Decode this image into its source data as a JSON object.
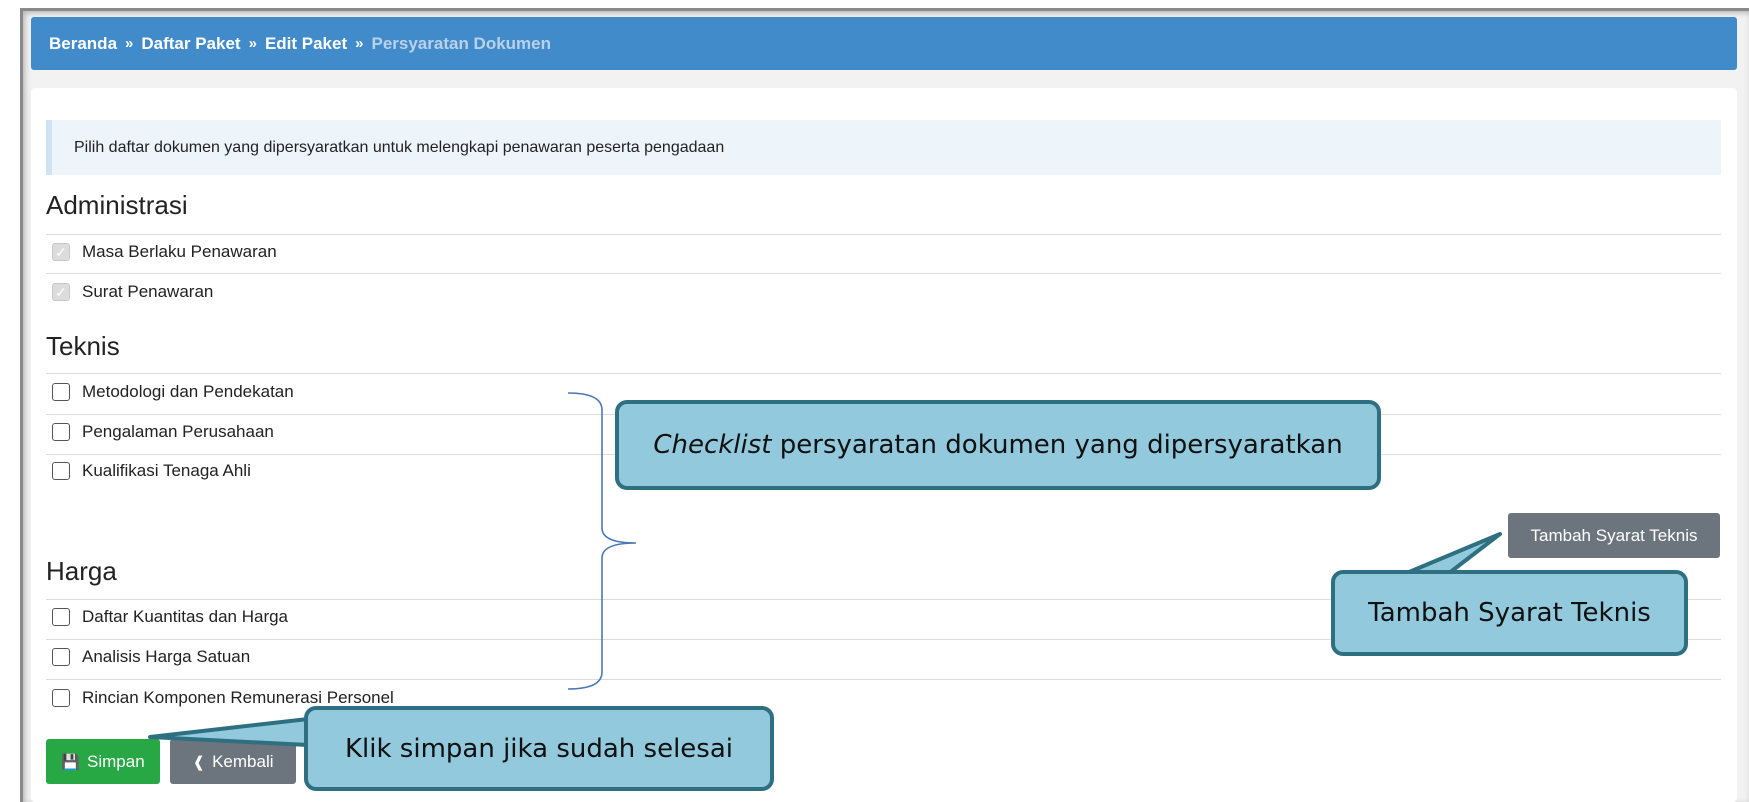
{
  "breadcrumb": {
    "items": [
      "Beranda",
      "Daftar Paket",
      "Edit Paket"
    ],
    "current": "Persyaratan Dokumen",
    "separator": "»"
  },
  "info_text": "Pilih daftar dokumen yang dipersyaratkan untuk melengkapi penawaran peserta pengadaan",
  "sections": {
    "administrasi": {
      "title": "Administrasi",
      "items": [
        {
          "label": "Masa Berlaku Penawaran",
          "checked": true,
          "disabled": true
        },
        {
          "label": "Surat Penawaran",
          "checked": true,
          "disabled": true
        }
      ]
    },
    "teknis": {
      "title": "Teknis",
      "items": [
        {
          "label": "Metodologi dan Pendekatan",
          "checked": false
        },
        {
          "label": "Pengalaman Perusahaan",
          "checked": false
        },
        {
          "label": "Kualifikasi Tenaga Ahli",
          "checked": false
        }
      ],
      "add_button": "Tambah Syarat Teknis"
    },
    "harga": {
      "title": "Harga",
      "items": [
        {
          "label": "Daftar Kuantitas dan Harga",
          "checked": false
        },
        {
          "label": "Analisis Harga Satuan",
          "checked": false
        },
        {
          "label": "Rincian Komponen Remunerasi Personel",
          "checked": false
        }
      ]
    }
  },
  "buttons": {
    "simpan": "Simpan",
    "kembali": "Kembali"
  },
  "callouts": {
    "checklist_em": "Checklist",
    "checklist_rest": " persyaratan dokumen yang dipersyaratkan",
    "tambah": "Tambah Syarat Teknis",
    "simpan": "Klik simpan jika sudah selesai"
  },
  "colors": {
    "breadcrumb_bg": "#428bca",
    "success": "#28a745",
    "secondary": "#6c757d",
    "callout_bg": "#92c9dc",
    "callout_border": "#2f6f82"
  }
}
